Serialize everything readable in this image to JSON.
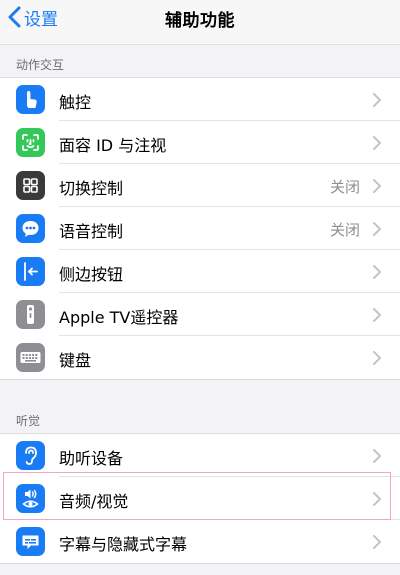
{
  "nav": {
    "back_label": "设置",
    "title": "辅助功能"
  },
  "sections": {
    "interaction": {
      "header": "动作交互",
      "items": [
        {
          "label": "触控",
          "value": "",
          "icon": "touch-hand-icon",
          "color": "#1a7cf5"
        },
        {
          "label": "面容 ID 与注视",
          "value": "",
          "icon": "face-id-icon",
          "color": "#34c759"
        },
        {
          "label": "切换控制",
          "value": "关闭",
          "icon": "switch-control-icon",
          "color": "#3a3a3c"
        },
        {
          "label": "语音控制",
          "value": "关闭",
          "icon": "voice-control-icon",
          "color": "#1a7cf5"
        },
        {
          "label": "侧边按钮",
          "value": "",
          "icon": "side-button-icon",
          "color": "#1a7cf5"
        },
        {
          "label": "Apple TV遥控器",
          "value": "",
          "icon": "apple-tv-remote-icon",
          "color": "#8e8e93"
        },
        {
          "label": "键盘",
          "value": "",
          "icon": "keyboard-icon",
          "color": "#8e8e93"
        }
      ]
    },
    "hearing": {
      "header": "听觉",
      "items": [
        {
          "label": "助听设备",
          "value": "",
          "icon": "ear-icon",
          "color": "#1a7cf5"
        },
        {
          "label": "音频/视觉",
          "value": "",
          "icon": "audio-visual-icon",
          "color": "#1a7cf5"
        },
        {
          "label": "字幕与隐藏式字幕",
          "value": "",
          "icon": "subtitles-icon",
          "color": "#1a7cf5"
        }
      ]
    }
  }
}
